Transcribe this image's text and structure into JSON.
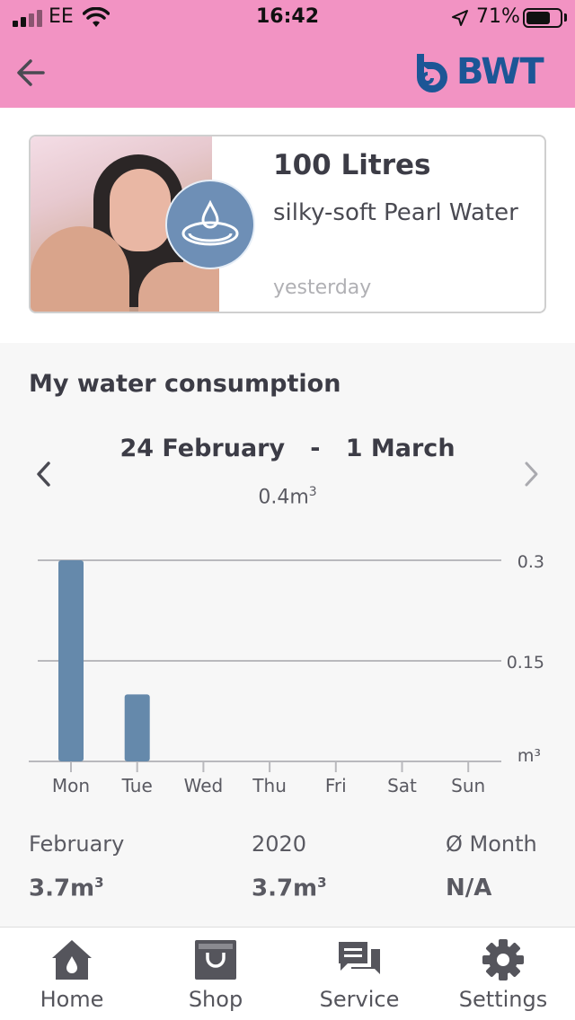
{
  "status_bar": {
    "carrier": "EE",
    "time": "16:42",
    "battery_percent": "71%",
    "battery_level": 0.71
  },
  "header": {
    "back_icon": "arrow-left-icon",
    "logo_text": "BWT",
    "brand_color": "#1c5696",
    "background_color": "#f293c3"
  },
  "card": {
    "title": "100 Litres",
    "subtitle": "silky-soft Pearl Water",
    "time": "yesterday",
    "icon": "water-drop-icon"
  },
  "consumption": {
    "title": "My water consumption",
    "range_start": "24 February",
    "range_separator": "-",
    "range_end": "1 March",
    "total_value": "0.4m",
    "total_sup": "3"
  },
  "chart_data": {
    "type": "bar",
    "categories": [
      "Mon",
      "Tue",
      "Wed",
      "Thu",
      "Fri",
      "Sat",
      "Sun"
    ],
    "values": [
      0.3,
      0.1,
      0,
      0,
      0,
      0,
      0
    ],
    "ylim": [
      0,
      0.3
    ],
    "yticks": [
      "0.3",
      "0.15"
    ],
    "yunit": "m³",
    "bar_color": "#6589ab",
    "grid": true
  },
  "stats": {
    "month_label": "February",
    "month_value": "3.7m",
    "year_label": "2020",
    "year_value": "3.7m",
    "avg_label": "Ø Month",
    "avg_value": "N/A",
    "unit_sup": "3"
  },
  "tabs": [
    {
      "label": "Home",
      "icon": "home-icon"
    },
    {
      "label": "Shop",
      "icon": "shopping-bag-icon"
    },
    {
      "label": "Service",
      "icon": "chat-icon"
    },
    {
      "label": "Settings",
      "icon": "gear-icon"
    }
  ]
}
